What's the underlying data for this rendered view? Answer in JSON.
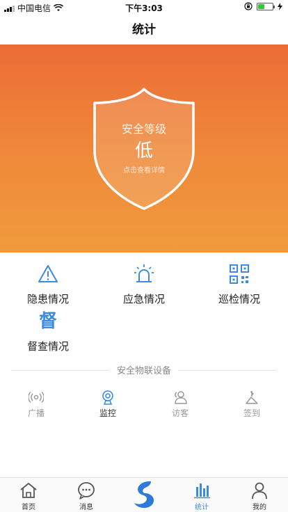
{
  "status_bar": {
    "carrier": "中国电信",
    "time": "下午3:03",
    "battery_level": 0.45
  },
  "nav": {
    "title": "统计"
  },
  "hero": {
    "shield_title": "安全等级",
    "level": "低",
    "hint": "点击查看详情"
  },
  "functions": [
    {
      "label": "隐患情况",
      "icon": "warning-icon"
    },
    {
      "label": "应急情况",
      "icon": "alarm-light-icon"
    },
    {
      "label": "巡检情况",
      "icon": "qr-code-icon"
    },
    {
      "label": "督查情况",
      "icon": "du-character-icon",
      "glyph": "督"
    }
  ],
  "iot": {
    "section_title": "安全物联设备",
    "tabs": [
      {
        "label": "广播",
        "icon": "broadcast-icon"
      },
      {
        "label": "监控",
        "icon": "camera-icon",
        "active": true
      },
      {
        "label": "访客",
        "icon": "visitors-icon"
      },
      {
        "label": "签到",
        "icon": "sign-in-icon"
      }
    ]
  },
  "tabbar": {
    "items": [
      {
        "label": "首页",
        "icon": "home-icon"
      },
      {
        "label": "消息",
        "icon": "message-icon"
      },
      {
        "label": "",
        "icon": "app-logo-icon"
      },
      {
        "label": "统计",
        "icon": "stats-icon",
        "active": true
      },
      {
        "label": "我的",
        "icon": "user-icon"
      }
    ]
  },
  "colors": {
    "accent": "#3b8be0",
    "hero_top": "#ec6c36",
    "hero_bottom": "#f09a3c"
  }
}
